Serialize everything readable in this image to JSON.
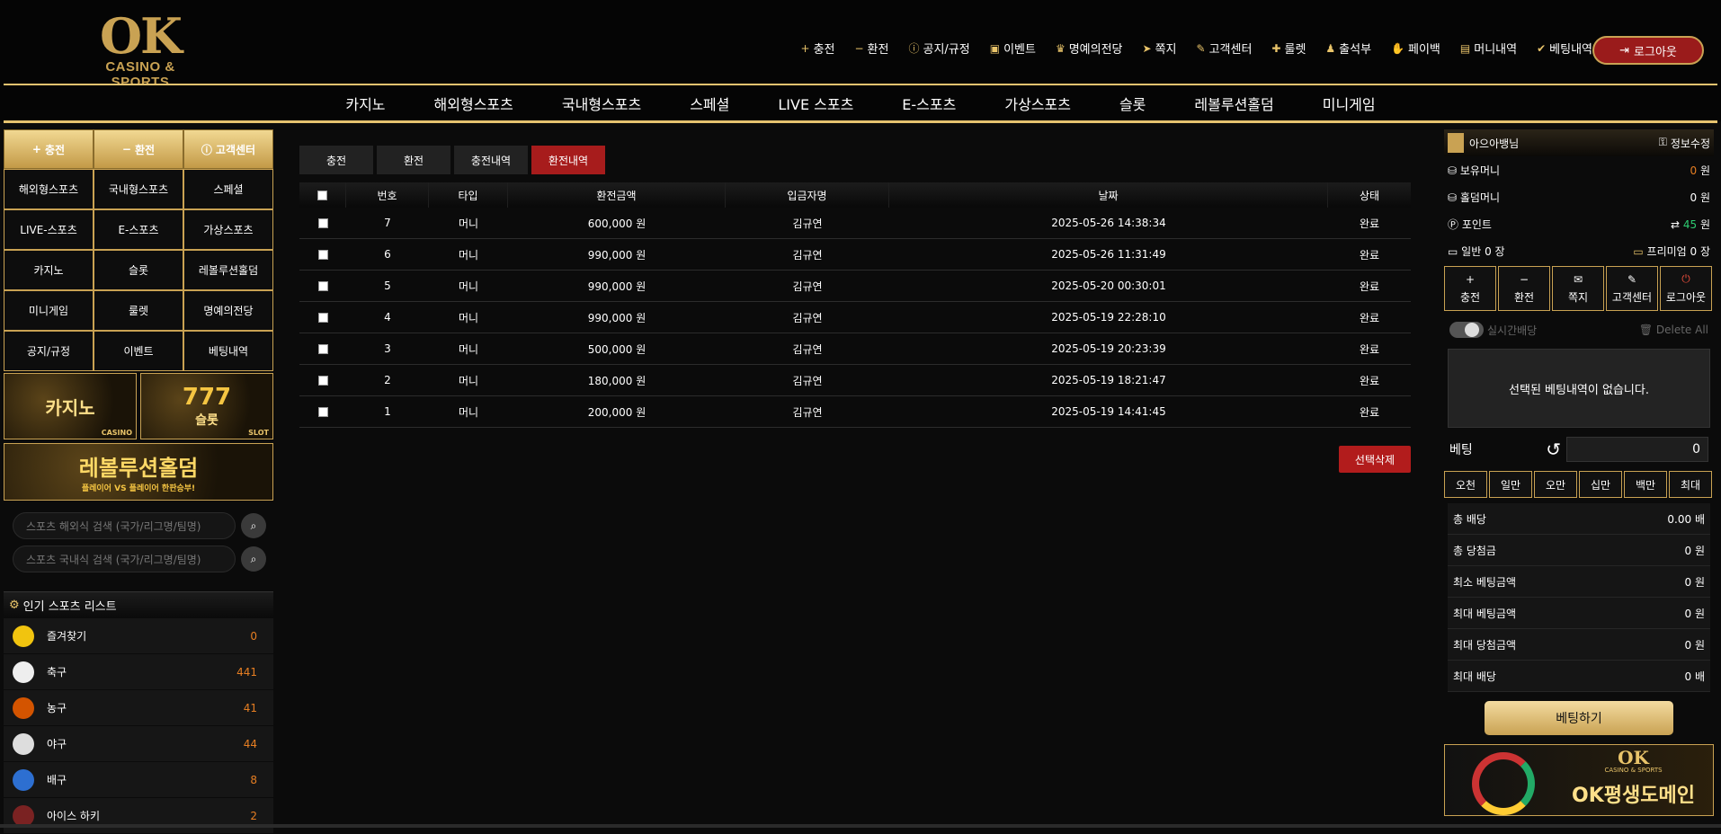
{
  "logo": {
    "main": "OK",
    "sub": "CASINO & SPORTS"
  },
  "topnav": [
    {
      "icon": "plus-icon",
      "glyph": "+",
      "label": "충전"
    },
    {
      "icon": "minus-icon",
      "glyph": "−",
      "label": "환전"
    },
    {
      "icon": "info-icon",
      "glyph": "ⓘ",
      "label": "공지/규정"
    },
    {
      "icon": "calendar-icon",
      "glyph": "▣",
      "label": "이벤트"
    },
    {
      "icon": "trophy-icon",
      "glyph": "♛",
      "label": "명예의전당"
    },
    {
      "icon": "paper-plane-icon",
      "glyph": "➤",
      "label": "쪽지"
    },
    {
      "icon": "edit-icon",
      "glyph": "✎",
      "label": "고객센터"
    },
    {
      "icon": "gift-icon",
      "glyph": "✚",
      "label": "룰렛"
    },
    {
      "icon": "user-check-icon",
      "glyph": "♟",
      "label": "출석부"
    },
    {
      "icon": "hand-icon",
      "glyph": "✋",
      "label": "페이백"
    },
    {
      "icon": "clipboard-icon",
      "glyph": "▤",
      "label": "머니내역"
    },
    {
      "icon": "check-icon",
      "glyph": "✔",
      "label": "베팅내역"
    }
  ],
  "logout_label": "로그아웃",
  "mainnav": [
    "카지노",
    "해외형스포츠",
    "국내형스포츠",
    "스페셜",
    "LIVE 스포츠",
    "E-스포츠",
    "가상스포츠",
    "슬롯",
    "레볼루션홀덤",
    "미니게임"
  ],
  "left": {
    "top": [
      {
        "label": "충전",
        "glyph": "+"
      },
      {
        "label": "환전",
        "glyph": "−"
      },
      {
        "label": "고객센터",
        "glyph": "ⓘ"
      }
    ],
    "grid": [
      "해외형스포츠",
      "국내형스포츠",
      "스페셜",
      "LIVE-스포츠",
      "E-스포츠",
      "가상스포츠",
      "카지노",
      "슬롯",
      "레볼루션홀덤",
      "미니게임",
      "룰렛",
      "명예의전당",
      "공지/규정",
      "이벤트",
      "베팅내역"
    ],
    "banner_casino": "카지노",
    "banner_casino_sub": "CASINO",
    "banner_slot": "슬롯",
    "banner_slot_num": "777",
    "banner_slot_sub": "SLOT",
    "banner_holdem": "레볼루션홀덤",
    "banner_holdem_sub": "플레이어 VS 플레이어 한판승부!",
    "search1": "스포츠 해외식 검색 (국가/리그명/팀명)",
    "search2": "스포츠 국내식 검색 (국가/리그명/팀명)",
    "popular_title": "인기 스포츠 리스트",
    "sports": [
      {
        "name": "즐겨찾기",
        "count": "0",
        "icon": "star-icon",
        "color": "#f1c40f"
      },
      {
        "name": "축구",
        "count": "441",
        "icon": "soccer-ball-icon",
        "color": "#eeeeee"
      },
      {
        "name": "농구",
        "count": "41",
        "icon": "basketball-icon",
        "color": "#d35400"
      },
      {
        "name": "야구",
        "count": "44",
        "icon": "baseball-icon",
        "color": "#dddddd"
      },
      {
        "name": "배구",
        "count": "8",
        "icon": "volleyball-icon",
        "color": "#2d6fd1"
      },
      {
        "name": "아이스 하키",
        "count": "2",
        "icon": "hockey-icon",
        "color": "#7a2222"
      }
    ]
  },
  "tabs": [
    {
      "label": "충전",
      "active": false
    },
    {
      "label": "환전",
      "active": false
    },
    {
      "label": "충전내역",
      "active": false
    },
    {
      "label": "환전내역",
      "active": true
    }
  ],
  "table": {
    "headers": [
      "번호",
      "타입",
      "환전금액",
      "입금자명",
      "날짜",
      "상태"
    ],
    "rows": [
      {
        "no": "7",
        "type": "머니",
        "amount": "600,000 원",
        "name": "김규연",
        "date": "2025-05-26 14:38:34",
        "status": "완료"
      },
      {
        "no": "6",
        "type": "머니",
        "amount": "990,000 원",
        "name": "김규연",
        "date": "2025-05-26 11:31:49",
        "status": "완료"
      },
      {
        "no": "5",
        "type": "머니",
        "amount": "990,000 원",
        "name": "김규연",
        "date": "2025-05-20 00:30:01",
        "status": "완료"
      },
      {
        "no": "4",
        "type": "머니",
        "amount": "990,000 원",
        "name": "김규연",
        "date": "2025-05-19 22:28:10",
        "status": "완료"
      },
      {
        "no": "3",
        "type": "머니",
        "amount": "500,000 원",
        "name": "김규연",
        "date": "2025-05-19 20:23:39",
        "status": "완료"
      },
      {
        "no": "2",
        "type": "머니",
        "amount": "180,000 원",
        "name": "김규연",
        "date": "2025-05-19 18:21:47",
        "status": "완료"
      },
      {
        "no": "1",
        "type": "머니",
        "amount": "200,000 원",
        "name": "김규연",
        "date": "2025-05-19 14:41:45",
        "status": "완료"
      }
    ],
    "delete_label": "선택삭제"
  },
  "right": {
    "username": "아으아뱅님",
    "edit_label": "정보수정",
    "money_label": "보유머니",
    "money_value": "0",
    "money_unit": "원",
    "hold_label": "홀덤머니",
    "hold_value": "0 원",
    "point_label": "포인트",
    "point_value": "45",
    "point_unit": "원",
    "coupon_label": "일반 0 장",
    "premium_label": "프리미엄 0 장",
    "quick": [
      {
        "label": "충전",
        "glyph": "+"
      },
      {
        "label": "환전",
        "glyph": "−"
      },
      {
        "label": "쪽지",
        "glyph": "✉"
      },
      {
        "label": "고객센터",
        "glyph": "✎"
      },
      {
        "label": "로그아웃",
        "glyph": "⏻"
      }
    ],
    "realtime_label": "실시간배당",
    "delete_all": "Delete All",
    "empty_msg": "선택된 베팅내역이 없습니다.",
    "bet_label": "베팅",
    "bet_value": "0",
    "amounts": [
      "오천",
      "일만",
      "오만",
      "십만",
      "백만",
      "최대"
    ],
    "summary": [
      {
        "label": "총 배당",
        "value": "0.00 배"
      },
      {
        "label": "총 당첨금",
        "value": "0 원"
      },
      {
        "label": "최소 베팅금액",
        "value": "0 원"
      },
      {
        "label": "최대 베팅금액",
        "value": "0 원"
      },
      {
        "label": "최대 당첨금액",
        "value": "0 원"
      },
      {
        "label": "최대 배당",
        "value": "0 배"
      }
    ],
    "bet_button": "베팅하기",
    "banner_logo": "OK",
    "banner_logo_sub": "CASINO & SPORTS",
    "banner_text": "OK평생도메인"
  },
  "colors": {
    "gold": "#c9a253",
    "red": "#a71c1c",
    "orange": "#e67e22"
  }
}
